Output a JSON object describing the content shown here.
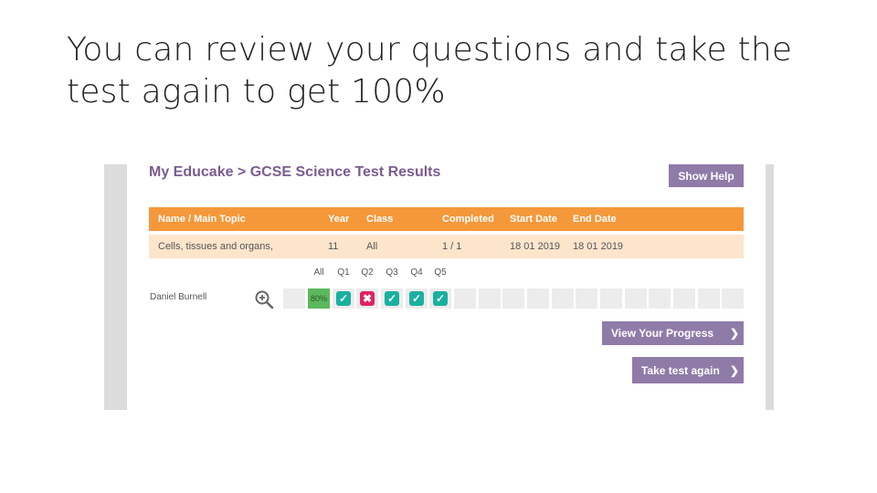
{
  "slide": {
    "title": "You can review your questions and take the test again to get 100%"
  },
  "app": {
    "heading": "My Educake > GCSE Science Test Results",
    "show_help": "Show Help"
  },
  "table": {
    "headers": {
      "name_topic": "Name / Main Topic",
      "year": "Year",
      "class": "Class",
      "completed": "Completed",
      "start_date": "Start Date",
      "end_date": "End Date"
    },
    "row": {
      "name_topic": "Cells, tissues and organs,",
      "year": "11",
      "class": "All",
      "completed": "1 / 1",
      "start_date": "18 01 2019",
      "end_date": "18 01 2019"
    }
  },
  "results": {
    "columns": [
      "All",
      "Q1",
      "Q2",
      "Q3",
      "Q4",
      "Q5"
    ],
    "student": "Daniel Burnell",
    "score": "80%",
    "answers": [
      "correct",
      "incorrect",
      "correct",
      "correct",
      "correct"
    ],
    "correct_glyph": "✓",
    "incorrect_glyph": "✖"
  },
  "buttons": {
    "view_progress": "View Your Progress",
    "take_again": "Take test again",
    "chevron": "❯"
  },
  "colors": {
    "brand_purple": "#8f7ba8",
    "heading_purple": "#7a5c91",
    "header_orange": "#f4983a",
    "row_peach": "#fde5cc",
    "correct": "#1ab0a0",
    "incorrect": "#e0245e",
    "score_green": "#5cb85c"
  },
  "icons": {
    "zoom": "zoom-in-icon",
    "chevron": "chevron-right-icon"
  }
}
